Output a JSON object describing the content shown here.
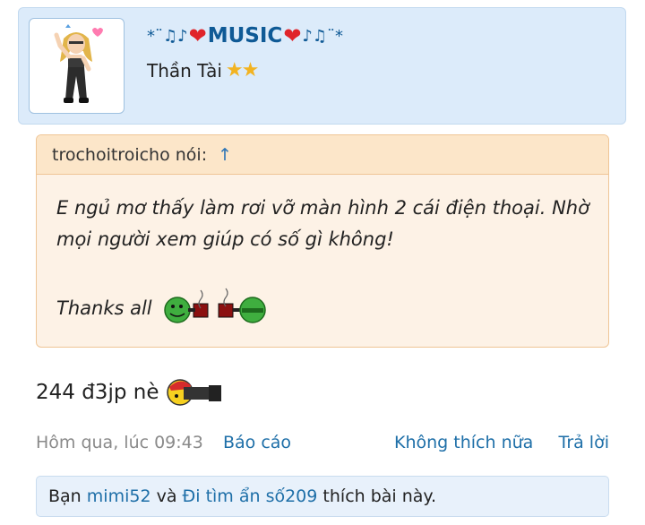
{
  "author": {
    "name_prefix": "*¨♫♪",
    "name_core": "MUSIC",
    "name_suffix": "♪♫¨*",
    "heart_glyph": "❤",
    "title": "Thần Tài",
    "stars": "★★",
    "accent_color": "#0f5a96"
  },
  "quote": {
    "header_user": "trochoitroicho nói:",
    "header_arrow": "↑",
    "line1": "E ngủ mơ thấy làm rơi vỡ màn hình 2 cái điện thoại. Nhờ",
    "line2": "mọi người xem giúp có số gì không!",
    "thanks": "Thanks all",
    "emoticon": "toast-emoticon"
  },
  "post": {
    "text": "244 đ3jp nè",
    "emoticon": "camera-emoticon"
  },
  "meta": {
    "time": "Hôm qua, lúc 09:43",
    "report": "Báo cáo",
    "unlike": "Không thích nữa",
    "reply": "Trả lời"
  },
  "likes": {
    "prefix": "Bạn",
    "user1": "mimi52",
    "conj": "và",
    "user2": "Đi tìm ẩn số209",
    "suffix": "thích bài này."
  }
}
